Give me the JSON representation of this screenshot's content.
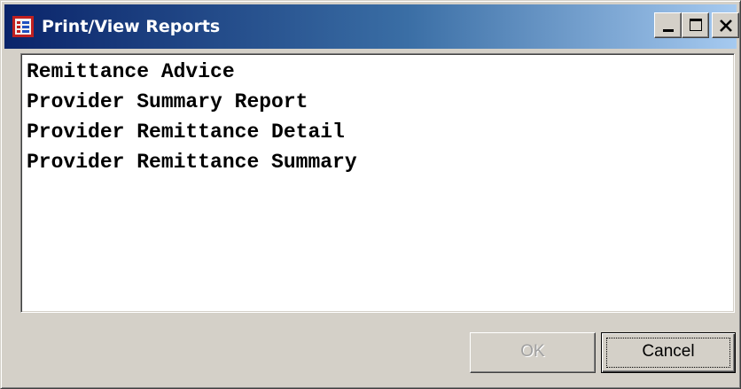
{
  "window": {
    "title": "Print/View Reports",
    "icon": "report-app-icon",
    "controls": {
      "minimize": "minimize-icon",
      "maximize": "maximize-icon",
      "close": "close-icon"
    }
  },
  "reports_list": {
    "items": [
      "Remittance Advice",
      "Provider Summary Report",
      "Provider Remittance Detail",
      "Provider Remittance Summary"
    ]
  },
  "buttons": {
    "ok_label": "OK",
    "ok_enabled": false,
    "cancel_label": "Cancel"
  },
  "colors": {
    "titlebar_start": "#0a246a",
    "titlebar_end": "#a6caf0",
    "face": "#d4d0c8",
    "list_background": "#ffffff",
    "disabled_text": "#a0a0a0"
  }
}
